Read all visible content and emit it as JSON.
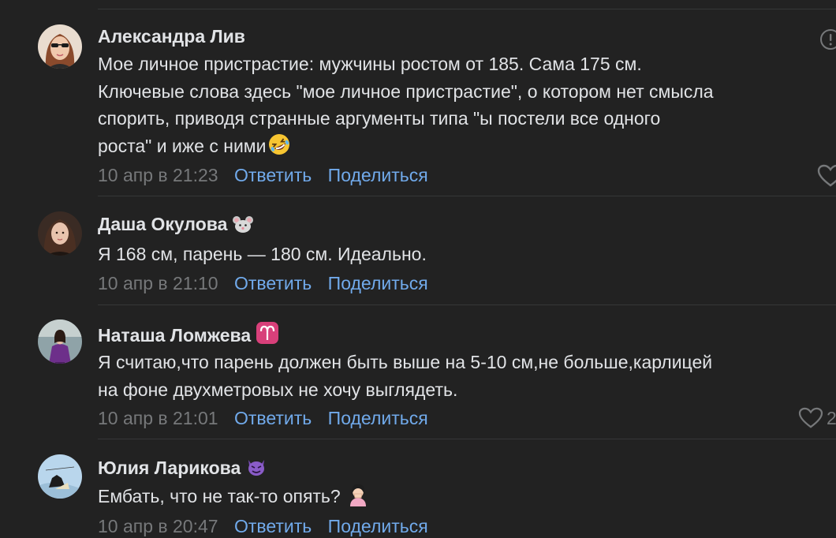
{
  "comments": [
    {
      "author": "Александра Лив",
      "lines": [
        "Мое личное пристрастие: мужчины ростом от 185. Сама 175 см.",
        "Ключевые слова здесь \"мое личное пристрастие\", о котором нет смысла",
        "спорить, приводя странные аргументы типа \"ы постели все одного",
        "роста\" и иже с ними"
      ],
      "trailing_emoji": "rolling-on-floor-laughing",
      "date": "10 апр в 21:23",
      "reply": "Ответить",
      "share": "Поделиться"
    },
    {
      "author": "Даша Окулова",
      "badge": "mouse-face",
      "lines": [
        "Я 168 см, парень — 180 см. Идеально."
      ],
      "date": "10 апр в 21:10",
      "reply": "Ответить",
      "share": "Поделиться"
    },
    {
      "author": "Наташа Ломжева",
      "badge": "aries",
      "lines": [
        "Я считаю,что парень должен быть выше на 5-10 см,не больше,карлицей",
        "на фоне двухметровых не хочу выглядеть."
      ],
      "date": "10 апр в 21:01",
      "reply": "Ответить",
      "share": "Поделиться",
      "like_count": "2"
    },
    {
      "author": "Юлия Ларикова",
      "badge": "smiling-face-with-horns",
      "lines": [
        "Ембать, что не так-то опять?"
      ],
      "trailing_emoji": "woman-facepalming",
      "date": "10 апр в 20:47",
      "reply": "Ответить",
      "share": "Поделиться"
    }
  ],
  "colors": {
    "background": "#222222",
    "text": "#e1e3e6",
    "meta": "#76787a",
    "link": "#71aaeb",
    "divider": "#363738"
  }
}
